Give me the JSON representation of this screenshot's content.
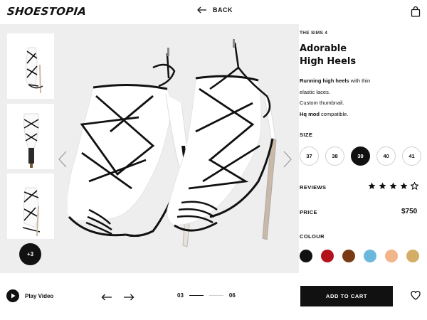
{
  "header": {
    "logo": "SHOESTOPIA",
    "back_label": "BACK"
  },
  "gallery": {
    "more_count": "+3",
    "thumbnails": [
      "thumbnail-front",
      "thumbnail-back",
      "thumbnail-side"
    ]
  },
  "product": {
    "category": "THE SIMS 4",
    "title_line1": "Adorable",
    "title_line2": "High Heels",
    "desc": [
      {
        "bold": "Running high heels",
        "text": " with thin"
      },
      {
        "bold": "",
        "text": "elastic laces."
      },
      {
        "bold": "",
        "text": "Custom thumbnail."
      },
      {
        "bold": "Hq mod",
        "text": " compatible."
      }
    ],
    "size_label": "SIZE",
    "sizes": [
      "37",
      "38",
      "39",
      "40",
      "41"
    ],
    "selected_size": "39",
    "reviews_label": "REVIEWS",
    "rating": 4,
    "rating_max": 5,
    "price_label": "PRICE",
    "price": "$750",
    "colour_label": "COLOUR",
    "colours": [
      "#111111",
      "#b3121a",
      "#7a3a14",
      "#6bb8dc",
      "#f2b48a",
      "#d4ad66"
    ]
  },
  "footer": {
    "play_label": "Play Video",
    "page_current": "03",
    "page_total": "06",
    "cart_label": "ADD TO CART"
  }
}
